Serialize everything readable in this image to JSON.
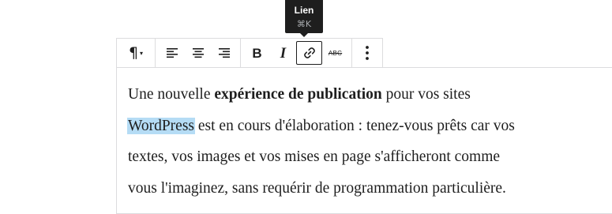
{
  "tooltip": {
    "label": "Lien",
    "shortcut": "⌘K"
  },
  "toolbar": {
    "paragraph_icon": "pilcrow-icon",
    "paragraph_glyph": "¶",
    "caret_glyph": "▾",
    "bold_label": "B",
    "italic_label": "I",
    "strikethrough_label": "ABC",
    "buttons": [
      "transform-paragraph-button",
      "align-left-button",
      "align-center-button",
      "align-right-button",
      "bold-button",
      "italic-button",
      "link-button",
      "strikethrough-button",
      "more-options-button"
    ],
    "active_button": "link-button"
  },
  "paragraph": {
    "line1_before": "Une nouvelle ",
    "line1_bold": "expérience de publication",
    "line1_after": " pour vos sites",
    "line2_selected": "WordPress",
    "line2_after": " est en cours d'élaboration : tenez-vous prêts car vos",
    "line3": "textes, vos images et vos mises en page s'afficheront comme",
    "line4": "vous l'imaginez, sans requérir de programmation particulière."
  },
  "colors": {
    "text": "#1e1e1e",
    "tooltip_bg": "#1e1e1e",
    "selection": "#b5dcf5",
    "border": "#dcdcde"
  }
}
